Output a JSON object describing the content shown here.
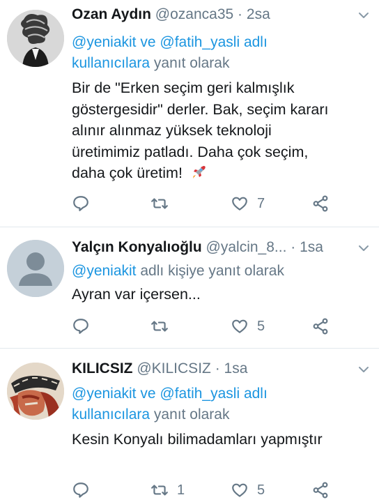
{
  "tweets": [
    {
      "name": "Ozan Aydın",
      "handle": "@ozanca35",
      "sep": "·",
      "time": "2sa",
      "reply_mentions": [
        "@yeniakit",
        "@fatih_yasli"
      ],
      "reply_conj": "ve",
      "reply_suffix1": "adlı",
      "reply_suffix2": "kullanıcılara",
      "reply_suffix3": "yanıt olarak",
      "text_lines": [
        "Bir de \"Erken seçim geri kalmışlık",
        "göstergesidir\" derler. Bak, seçim kararı",
        "alınır alınmaz yüksek teknoloji",
        "üretimimiz patladı. Daha çok seçim,",
        "daha çok üretim!"
      ],
      "emoji": "rocket-icon",
      "retweets": "",
      "likes": "7"
    },
    {
      "name": "Yalçın Konyalıoğlu",
      "handle": "@yalcin_8...",
      "sep": "·",
      "time": "1sa",
      "reply_mention": "@yeniakit",
      "reply_suffix": "adlı kişiye yanıt olarak",
      "text": "Ayran var içersen...",
      "retweets": "",
      "likes": "5"
    },
    {
      "name": "KILICSIZ",
      "handle": "@KILICSIZ",
      "sep": "·",
      "time": "1sa",
      "reply_mentions": [
        "@yeniakit",
        "@fatih_yasli"
      ],
      "reply_conj": "ve",
      "reply_suffix1": "adlı",
      "reply_suffix2": "kullanıcılara",
      "reply_suffix3": "yanıt olarak",
      "text": "Kesin Konyalı bilimadamları yapmıştır",
      "retweets": "1",
      "likes": "5"
    }
  ],
  "colors": {
    "link": "#1b95e0",
    "muted": "#657786",
    "text": "#14171a",
    "divider": "#e1e8ed"
  }
}
